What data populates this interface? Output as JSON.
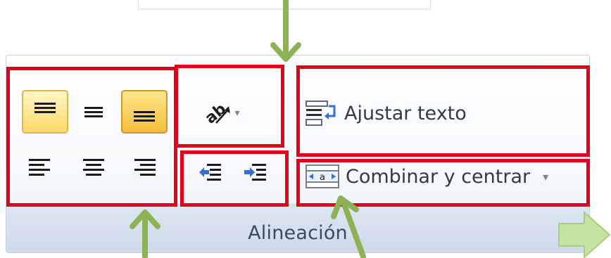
{
  "ribbon": {
    "group_title": "Alineación",
    "wrap_text_label": "Ajustar texto",
    "merge_center_label": "Combinar y centrar",
    "merge_dropdown_glyph": "▾",
    "orientation_dropdown_glyph": "▾",
    "merge_icon_text": "a"
  },
  "buttons": {
    "align_top": {
      "icon": "align-top-icon",
      "pressed": true
    },
    "align_middle": {
      "icon": "align-middle-icon",
      "pressed": false
    },
    "align_bottom": {
      "icon": "align-bottom-icon",
      "pressed": true
    },
    "align_left": {
      "icon": "align-left-icon",
      "pressed": false
    },
    "align_center": {
      "icon": "align-center-icon",
      "pressed": false
    },
    "align_right": {
      "icon": "align-right-icon",
      "pressed": false
    },
    "orientation": {
      "icon": "text-orientation-icon"
    },
    "decrease_indent": {
      "icon": "decrease-indent-icon"
    },
    "increase_indent": {
      "icon": "increase-indent-icon"
    },
    "wrap_text": {
      "icon": "wrap-text-icon"
    },
    "merge_center": {
      "icon": "merge-center-icon"
    },
    "dialog_launcher": {
      "icon": "dialog-launcher-icon"
    }
  },
  "annotations": {
    "highlight_color": "#e2001a",
    "arrow_color": "#8db255",
    "callout_arrow_color": "#c4e3a0"
  }
}
